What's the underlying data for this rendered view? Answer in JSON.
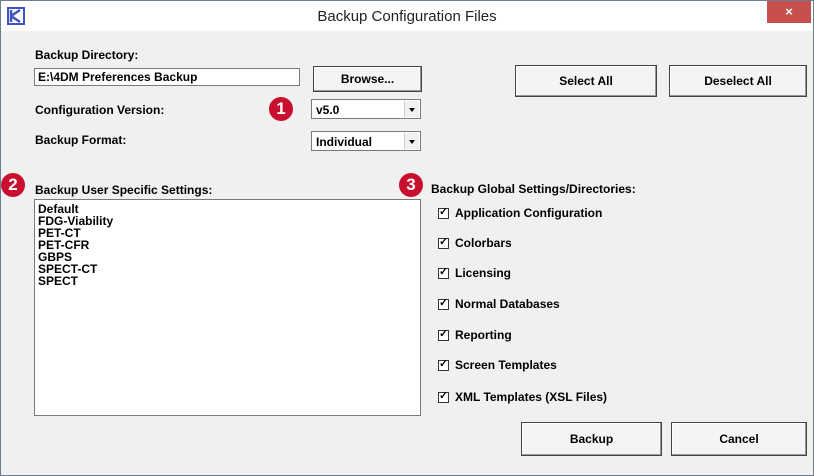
{
  "window": {
    "title": "Backup Configuration Files",
    "close_label": "×"
  },
  "backup_directory": {
    "label": "Backup Directory:",
    "value": "E:\\4DM Preferences Backup",
    "browse_label": "Browse..."
  },
  "configuration_version": {
    "label": "Configuration Version:",
    "value": "v5.0"
  },
  "backup_format": {
    "label": "Backup Format:",
    "value": "Individual"
  },
  "select_all_label": "Select All",
  "deselect_all_label": "Deselect All",
  "callouts": {
    "one": "1",
    "two": "2",
    "three": "3",
    "color": "#c8102e"
  },
  "user_settings": {
    "label": "Backup User Specific Settings:",
    "items": [
      "Default",
      "FDG-Viability",
      "PET-CT",
      "PET-CFR",
      "GBPS",
      "SPECT-CT",
      "SPECT"
    ]
  },
  "global_settings": {
    "label": "Backup Global Settings/Directories:",
    "items": [
      {
        "label": "Application Configuration",
        "checked": true
      },
      {
        "label": "Colorbars",
        "checked": true
      },
      {
        "label": "Licensing",
        "checked": true
      },
      {
        "label": "Normal Databases",
        "checked": true
      },
      {
        "label": "Reporting",
        "checked": true
      },
      {
        "label": "Screen Templates",
        "checked": true
      },
      {
        "label": "XML Templates (XSL Files)",
        "checked": true
      }
    ],
    "check_mark": "✓"
  },
  "backup_label": "Backup",
  "cancel_label": "Cancel"
}
